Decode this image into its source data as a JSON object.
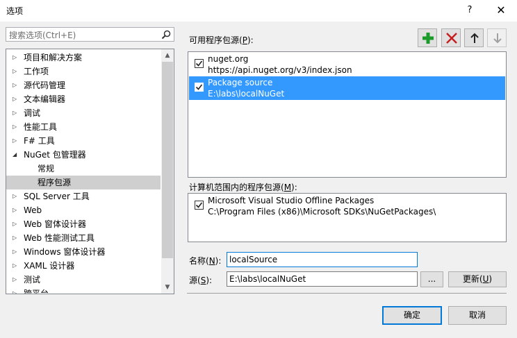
{
  "window": {
    "title": "选项",
    "help_label": "?",
    "close_label": "✕"
  },
  "search": {
    "placeholder": "搜索选项(Ctrl+E)"
  },
  "tree": {
    "items": [
      {
        "label": "项目和解决方案",
        "expand": "▷"
      },
      {
        "label": "工作项",
        "expand": "▷"
      },
      {
        "label": "源代码管理",
        "expand": "▷"
      },
      {
        "label": "文本编辑器",
        "expand": "▷"
      },
      {
        "label": "调试",
        "expand": "▷"
      },
      {
        "label": "性能工具",
        "expand": "▷"
      },
      {
        "label": "F# 工具",
        "expand": "▷"
      },
      {
        "label": "NuGet 包管理器",
        "expand": "◢"
      },
      {
        "label": "常规",
        "expand": ""
      },
      {
        "label": "程序包源",
        "expand": ""
      },
      {
        "label": "SQL Server 工具",
        "expand": "▷"
      },
      {
        "label": "Web",
        "expand": "▷"
      },
      {
        "label": "Web 窗体设计器",
        "expand": "▷"
      },
      {
        "label": "Web 性能测试工具",
        "expand": "▷"
      },
      {
        "label": "Windows 窗体设计器",
        "expand": "▷"
      },
      {
        "label": "XAML 设计器",
        "expand": "▷"
      },
      {
        "label": "测试",
        "expand": "▷"
      },
      {
        "label": "跨平台",
        "expand": "▷"
      }
    ],
    "selected_index": 9
  },
  "available_sources": {
    "label_pre": "可用程序包源(",
    "label_key": "P",
    "label_post": "):",
    "items": [
      {
        "name": "nuget.org",
        "url": "https://api.nuget.org/v3/index.json",
        "checked": true,
        "selected": false
      },
      {
        "name": "Package source",
        "url": "E:\\labs\\localNuGet",
        "checked": true,
        "selected": true
      }
    ]
  },
  "machine_sources": {
    "label_pre": "计算机范围内的程序包源(",
    "label_key": "M",
    "label_post": "):",
    "items": [
      {
        "name": "Microsoft Visual Studio Offline Packages",
        "url": "C:\\Program Files (x86)\\Microsoft SDKs\\NuGetPackages\\",
        "checked": true
      }
    ]
  },
  "form": {
    "name_label_pre": "名称(",
    "name_label_key": "N",
    "name_label_post": "):",
    "name_value": "localSource",
    "source_label_pre": "源(",
    "source_label_key": "S",
    "source_label_post": "):",
    "source_value": "E:\\labs\\localNuGet",
    "browse_label": "...",
    "update_pre": "更新(",
    "update_key": "U",
    "update_post": ")"
  },
  "buttons": {
    "ok_label": "确定",
    "cancel_label": "取消"
  },
  "colors": {
    "selection": "#3399ff",
    "add": "#1b9c2a",
    "remove": "#c41e1e",
    "focus_border": "#0078d7"
  }
}
